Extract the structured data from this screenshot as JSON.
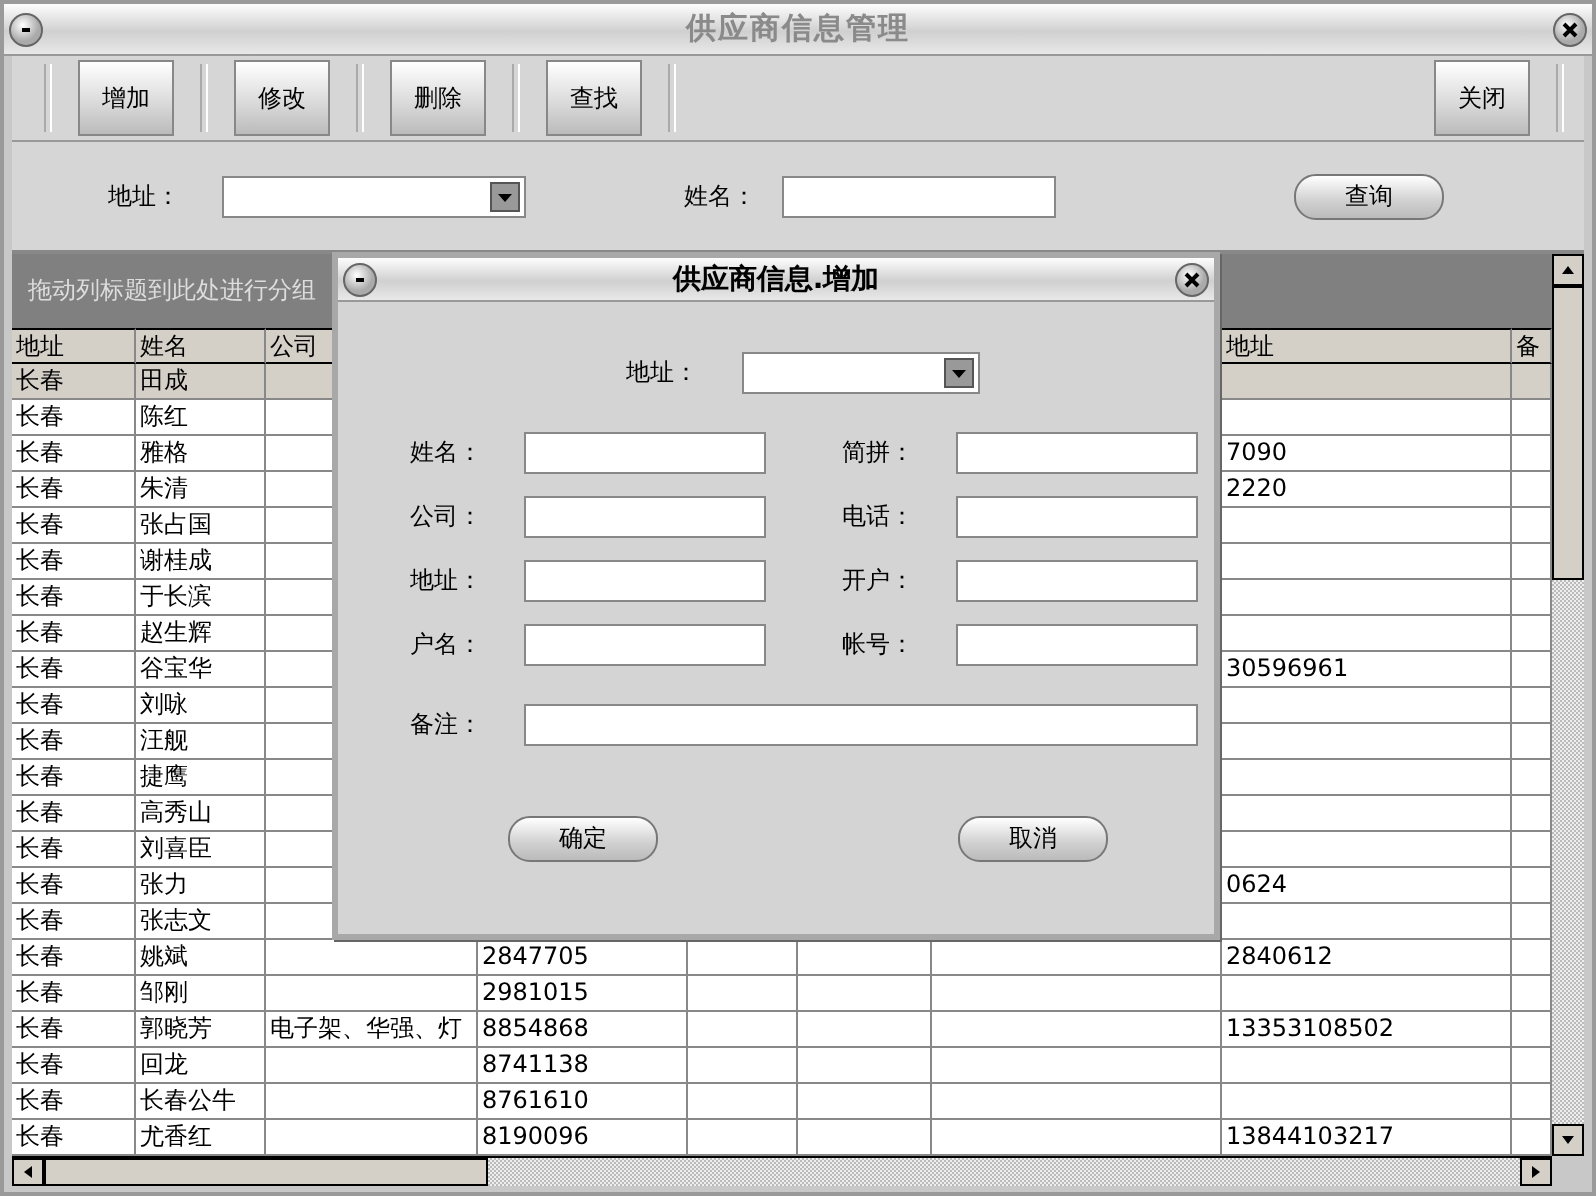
{
  "window": {
    "title": "供应商信息管理"
  },
  "toolbar": {
    "buttons": [
      "增加",
      "修改",
      "删除",
      "查找"
    ],
    "close_button": "关闭"
  },
  "search": {
    "address_label": "地址：",
    "name_label": "姓名：",
    "query_button": "查询"
  },
  "group_panel": {
    "hint": "拖动列标题到此处进行分组"
  },
  "table": {
    "columns": {
      "address": "地址",
      "name": "姓名",
      "company": "公司",
      "column_8": "地址",
      "column_9": "备"
    },
    "rows": [
      {
        "address": "长春",
        "name": "田成",
        "selected": true
      },
      {
        "address": "长春",
        "name": "陈红",
        "selected": false
      },
      {
        "address": "长春",
        "name": "雅格",
        "column_8": "7090",
        "selected": false
      },
      {
        "address": "长春",
        "name": "朱清",
        "column_8": "2220",
        "selected": false
      },
      {
        "address": "长春",
        "name": "张占国",
        "selected": false
      },
      {
        "address": "长春",
        "name": "谢桂成",
        "selected": false
      },
      {
        "address": "长春",
        "name": "于长滨",
        "selected": false
      },
      {
        "address": "长春",
        "name": "赵生辉",
        "selected": false
      },
      {
        "address": "长春",
        "name": "谷宝华",
        "column_8": "30596961",
        "selected": false
      },
      {
        "address": "长春",
        "name": "刘咏",
        "selected": false
      },
      {
        "address": "长春",
        "name": "汪舰",
        "selected": false
      },
      {
        "address": "长春",
        "name": "捷鹰",
        "selected": false
      },
      {
        "address": "长春",
        "name": "高秀山",
        "selected": false
      },
      {
        "address": "长春",
        "name": "刘喜臣",
        "selected": false
      },
      {
        "address": "长春",
        "name": "张力",
        "column_8": "0624",
        "selected": false
      },
      {
        "address": "长春",
        "name": "张志文",
        "selected": false
      },
      {
        "address": "长春",
        "name": "姚斌",
        "column_4": "2847705",
        "column_8": "2840612",
        "selected": false
      },
      {
        "address": "长春",
        "name": "邹刚",
        "column_4": "2981015",
        "selected": false
      },
      {
        "address": "长春",
        "name": "郭晓芳",
        "company": "电子架、华强、灯",
        "column_4": "8854868",
        "column_8": "13353108502",
        "selected": false
      },
      {
        "address": "长春",
        "name": "回龙",
        "column_4": "8741138",
        "selected": false
      },
      {
        "address": "长春",
        "name": "长春公牛",
        "column_4": "8761610",
        "selected": false
      },
      {
        "address": "长春",
        "name": "尤香红",
        "column_4": "8190096",
        "column_8": "13844103217",
        "selected": false
      }
    ]
  },
  "dialog": {
    "title": "供应商信息.增加",
    "address_label": "地址：",
    "fields": [
      [
        "姓名：",
        "简拼："
      ],
      [
        "公司：",
        "电话："
      ],
      [
        "地址：",
        "开户："
      ],
      [
        "户名：",
        "帐号："
      ]
    ],
    "remark_label": "备注：",
    "ok_button": "确定",
    "cancel_button": "取消"
  }
}
